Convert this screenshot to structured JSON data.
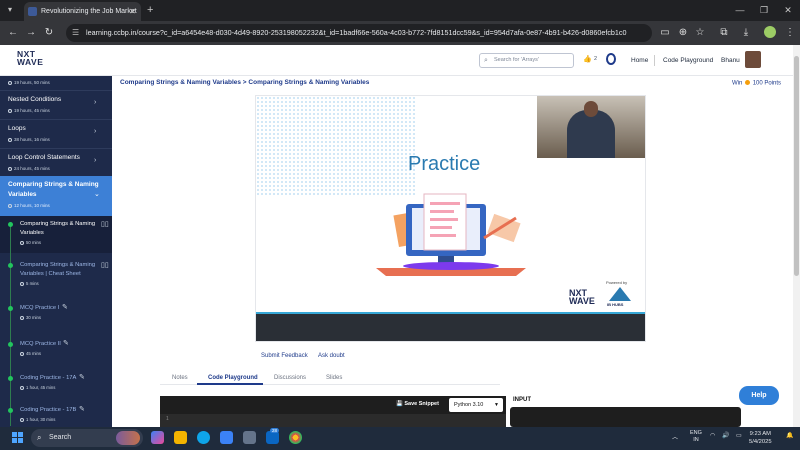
{
  "browser": {
    "tab_title": "Revolutionizing the Job Market",
    "url": "learning.ccbp.in/course?c_id=a6454e48-d030-4d49-8920-253198052232&t_id=1badf66e-560a-4c03-b772-7fd8151dcc59&s_id=954d7afa-0e87-4b91-b426-d0860efcb1c0"
  },
  "header": {
    "logo_top": "NXT",
    "logo_bottom": "WAVE",
    "search_placeholder": "Search for 'Arrays'",
    "streak_count": "2",
    "nav_home": "Home",
    "nav_playground": "Code Playground",
    "user_name": "Bhanu"
  },
  "sidebar": {
    "top_meta": "19 hours, 50 mins",
    "modules": [
      {
        "title": "Nested Conditions",
        "meta": "19 hours, 45 mins"
      },
      {
        "title": "Loops",
        "meta": "38 hours, 16 mins"
      },
      {
        "title": "Loop Control Statements",
        "meta": "24 hours, 45 mins"
      }
    ],
    "active_module": {
      "title_line1": "Comparing Strings & Naming",
      "title_line2": "Variables",
      "meta": "12 hours, 10 mins"
    },
    "sub_items": [
      {
        "line1": "Comparing Strings & Naming",
        "line2": "Variables",
        "meta": "50 mins"
      },
      {
        "line1": "Comparing Strings & Naming",
        "line2": "Variables | Cheat Sheet",
        "meta": "5 mins"
      },
      {
        "line1": "MCQ Practice I",
        "line2": "",
        "meta": "30 mins"
      },
      {
        "line1": "MCQ Practice II",
        "line2": "",
        "meta": "45 mins"
      },
      {
        "line1": "Coding Practice - 17A",
        "line2": "",
        "meta": "1 hour, 45 mins"
      },
      {
        "line1": "Coding Practice - 17B",
        "line2": "",
        "meta": "1 hour, 30 mins"
      }
    ]
  },
  "main": {
    "breadcrumb": "Comparing Strings & Naming Variables > Comparing Strings & Naming Variables",
    "win_label": "Win",
    "win_points": "100 Points",
    "slide_title": "Practice",
    "slide_logo_top": "NXT",
    "slide_logo_bottom": "WAVE",
    "slide_powered": "Powered by",
    "slide_hubs": "IB HUBS",
    "submit_feedback": "Submit Feedback",
    "ask_doubt": "Ask doubt",
    "tabs": [
      "Notes",
      "Code Playground",
      "Discussions",
      "Slides"
    ],
    "save_snippet": "Save Snippet",
    "language": "Python 3.10",
    "line_number": "1",
    "input_label": "INPUT",
    "help": "Help"
  },
  "taskbar": {
    "search_label": "Search",
    "badge": "28",
    "lang_line1": "ENG",
    "lang_line2": "IN",
    "time": "9:23 AM",
    "date": "5/4/2025"
  }
}
